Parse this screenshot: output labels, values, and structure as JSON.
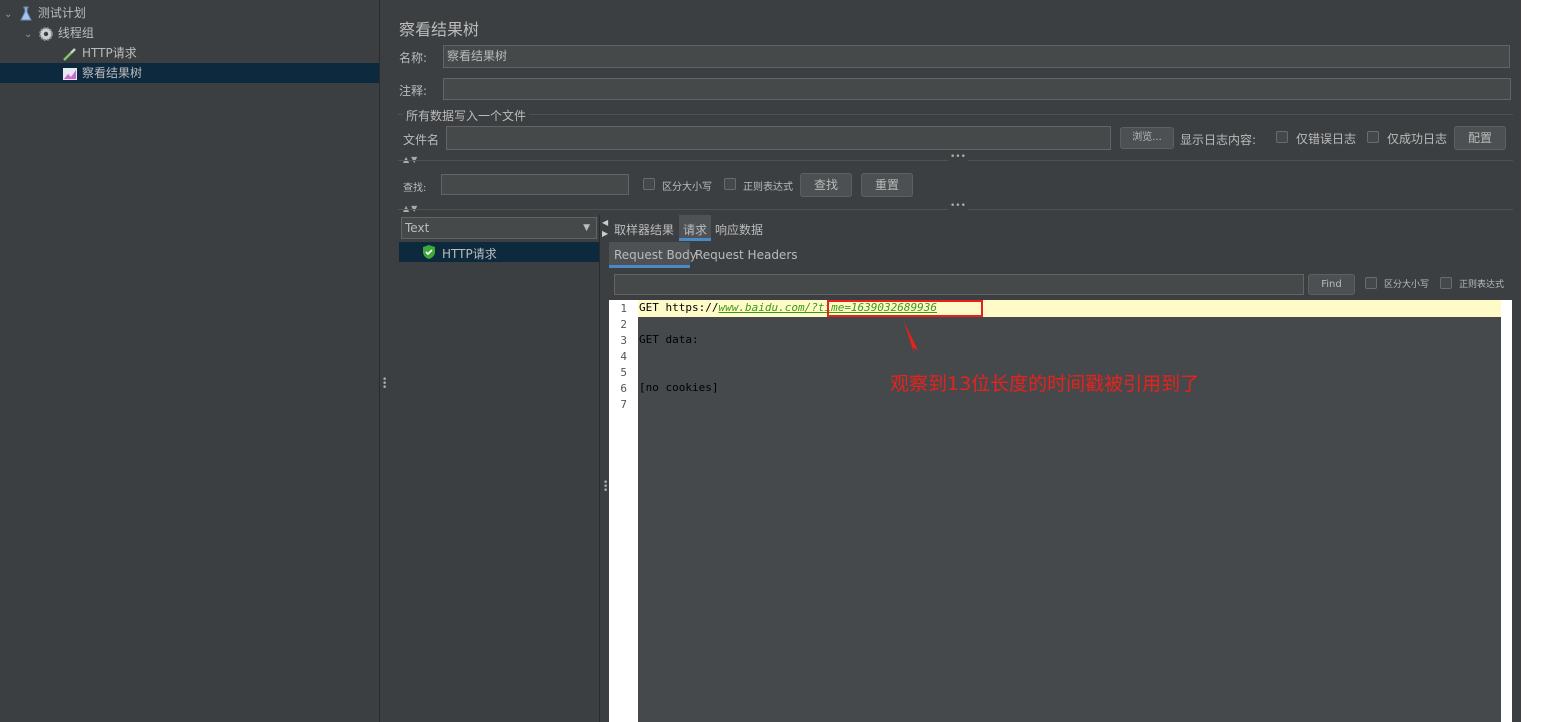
{
  "tree": {
    "items": [
      {
        "label": "测试计划",
        "icon": "flask-icon"
      },
      {
        "label": "线程组",
        "icon": "gear-icon"
      },
      {
        "label": "HTTP请求",
        "icon": "pipette-icon"
      },
      {
        "label": "察看结果树",
        "icon": "chart-icon"
      }
    ]
  },
  "panel": {
    "title": "察看结果树",
    "name_label": "名称:",
    "name_value": "察看结果树",
    "comment_label": "注释:",
    "comment_value": "",
    "file_section_title": "所有数据写入一个文件",
    "filename_label": "文件名",
    "filename_value": "",
    "browse_button": "浏览...",
    "log_display_label": "显示日志内容:",
    "errors_only_label": "仅错误日志",
    "success_only_label": "仅成功日志",
    "configure_button": "配置"
  },
  "search": {
    "label": "查找:",
    "value": "",
    "case_sensitive_label": "区分大小写",
    "regex_label": "正则表达式",
    "find_button": "查找",
    "reset_button": "重置"
  },
  "results": {
    "renderer_select": "Text",
    "samples": [
      {
        "label": "HTTP请求",
        "status": "success"
      }
    ]
  },
  "tabs": [
    {
      "label": "取样器结果",
      "active": false
    },
    {
      "label": "请求",
      "active": true
    },
    {
      "label": "响应数据",
      "active": false
    }
  ],
  "subtabs": [
    {
      "label": "Request Body",
      "active": true
    },
    {
      "label": "Request Headers",
      "active": false
    }
  ],
  "request_search": {
    "value": "",
    "find_button": "Find",
    "case_sensitive_label": "区分大小写",
    "regex_label": "正则表达式"
  },
  "code": {
    "line_numbers": [
      "1",
      "2",
      "3",
      "4",
      "5",
      "6",
      "7"
    ],
    "line1_prefix": "GET https://",
    "line1_link": "www.baidu.com/?time=1639032689936",
    "line3": "GET data:",
    "line6": "[no cookies]"
  },
  "annotation": {
    "text": "观察到13位长度的时间戳被引用到了",
    "color": "#e8211c"
  },
  "colors": {
    "background": "#3c3f41",
    "selection": "#0d293e",
    "highlight_line": "#fffbc9",
    "annotation_red": "#e8211c"
  }
}
